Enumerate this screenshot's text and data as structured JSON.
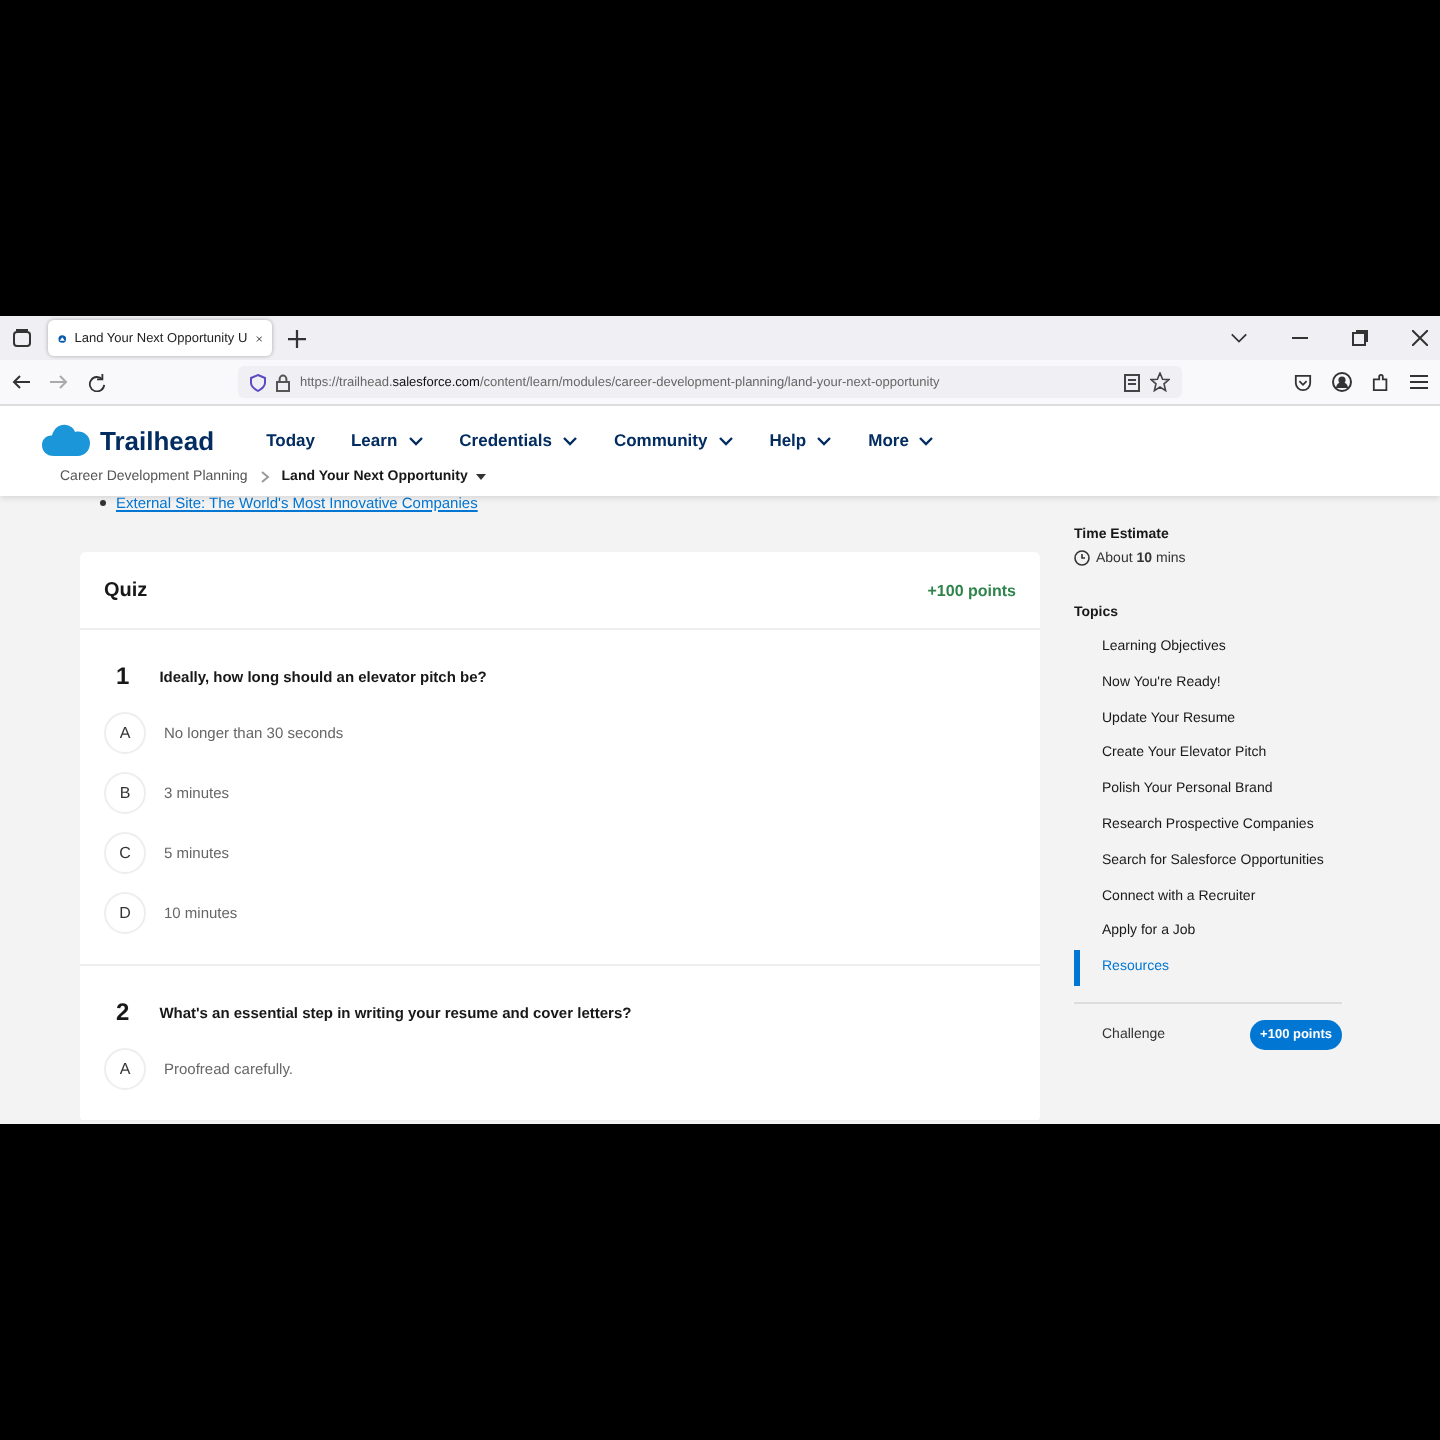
{
  "browser": {
    "tab_title": "Land Your Next Opportunity U",
    "url_start": "https://trailhead.",
    "url_domain": "salesforce.com",
    "url_rest": "/content/learn/modules/career-development-planning/land-your-next-opportunity"
  },
  "header": {
    "logo": "Trailhead",
    "nav": [
      {
        "label": "Today",
        "dropdown": false
      },
      {
        "label": "Learn",
        "dropdown": true
      },
      {
        "label": "Credentials",
        "dropdown": true
      },
      {
        "label": "Community",
        "dropdown": true
      },
      {
        "label": "Help",
        "dropdown": true
      },
      {
        "label": "More",
        "dropdown": true
      }
    ],
    "breadcrumb": [
      {
        "label": "Career Development Planning",
        "current": false
      },
      {
        "label": "Land Your Next Opportunity",
        "current": true
      }
    ]
  },
  "resource_link": "External Site: The World's Most Innovative Companies",
  "quiz": {
    "title": "Quiz",
    "points": "+100 points",
    "questions": [
      {
        "number": "1",
        "text": "Ideally, how long should an elevator pitch be?",
        "options": [
          {
            "letter": "A",
            "text": "No longer than 30 seconds"
          },
          {
            "letter": "B",
            "text": "3 minutes"
          },
          {
            "letter": "C",
            "text": "5 minutes"
          },
          {
            "letter": "D",
            "text": "10 minutes"
          }
        ]
      },
      {
        "number": "2",
        "text": "What's an essential step in writing your resume and cover letters?",
        "options": [
          {
            "letter": "A",
            "text": "Proofread carefully."
          }
        ]
      }
    ]
  },
  "sidebar": {
    "time_title": "Time Estimate",
    "time": "About **10** mins",
    "topics_title": "Topics",
    "topics": [
      {
        "label": "Learning Objectives",
        "selected": false
      },
      {
        "label": "Now You're Ready!",
        "selected": false
      },
      {
        "label": "Update Your Resume",
        "selected": false
      },
      {
        "label": "Create Your Elevator Pitch",
        "selected": false
      },
      {
        "label": "Polish Your Personal Brand",
        "selected": false
      },
      {
        "label": "Research Prospective Companies",
        "selected": false
      },
      {
        "label": "Search for Salesforce Opportunities",
        "selected": false
      },
      {
        "label": "Connect with a Recruiter",
        "selected": false
      },
      {
        "label": "Apply for a Job",
        "selected": false
      },
      {
        "label": "Resources",
        "selected": true
      }
    ],
    "challenge": {
      "label": "Challenge",
      "points": "+100 points"
    }
  }
}
